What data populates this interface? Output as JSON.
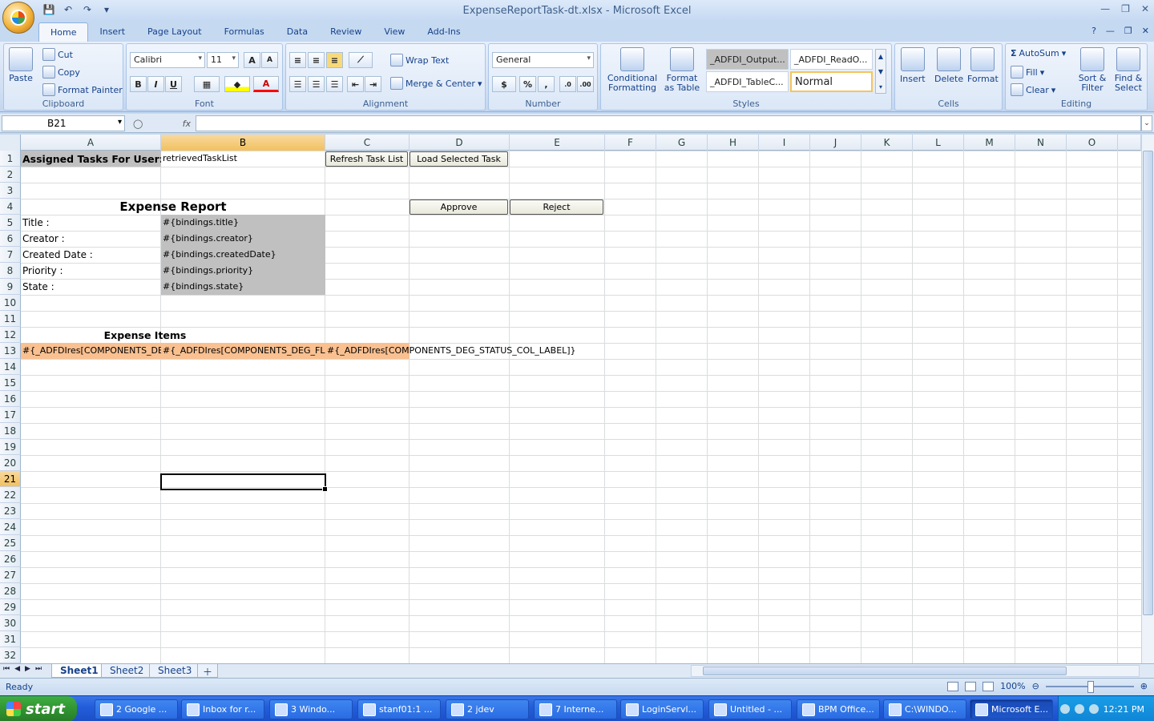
{
  "window": {
    "title": "ExpenseReportTask-dt.xlsx - Microsoft Excel"
  },
  "ribbon": {
    "tabs": [
      "Home",
      "Insert",
      "Page Layout",
      "Formulas",
      "Data",
      "Review",
      "View",
      "Add-Ins"
    ],
    "clipboard": {
      "paste": "Paste",
      "cut": "Cut",
      "copy": "Copy",
      "format_painter": "Format Painter",
      "label": "Clipboard"
    },
    "font": {
      "name": "Calibri",
      "size": "11",
      "bold": "B",
      "italic": "I",
      "underline": "U",
      "label": "Font"
    },
    "alignment": {
      "wrap_text": "Wrap Text",
      "merge_center": "Merge & Center",
      "label": "Alignment"
    },
    "number": {
      "format": "General",
      "currency": "$",
      "percent": "%",
      "comma": ",",
      "label": "Number"
    },
    "styles": {
      "conditional_formatting": "Conditional Formatting",
      "format_as_table": "Format as Table",
      "cells": [
        "_ADFDI_Output...",
        "_ADFDI_ReadO...",
        "_ADFDI_TableC...",
        "Normal"
      ],
      "label": "Styles"
    },
    "cells_group": {
      "insert": "Insert",
      "delete": "Delete",
      "format": "Format",
      "label": "Cells"
    },
    "editing": {
      "autosum": "AutoSum",
      "fill": "Fill",
      "clear": "Clear",
      "sort_filter": "Sort & Filter",
      "find_select": "Find & Select",
      "label": "Editing"
    }
  },
  "formula_bar": {
    "name_box": "B21",
    "fx": "fx",
    "value": ""
  },
  "columns": [
    "A",
    "B",
    "C",
    "D",
    "E",
    "F",
    "G",
    "H",
    "I",
    "J",
    "K",
    "L",
    "M",
    "N",
    "O"
  ],
  "rows": [
    "1",
    "2",
    "3",
    "4",
    "5",
    "6",
    "7",
    "8",
    "9",
    "10",
    "11",
    "12",
    "13",
    "14",
    "15",
    "16",
    "17",
    "18",
    "19",
    "20",
    "21",
    "22",
    "23",
    "24",
    "25",
    "26",
    "27",
    "28",
    "29",
    "30",
    "31",
    "32"
  ],
  "sheet": {
    "a1": "Assigned Tasks For User:",
    "b1": "retrievedTaskList",
    "refresh_btn": "Refresh Task List",
    "load_btn": "Load Selected Task",
    "heading": "Expense Report",
    "approve_btn": "Approve",
    "reject_btn": "Reject",
    "labels": [
      "Title :",
      "Creator :",
      "Created Date :",
      "Priority :",
      "State :"
    ],
    "bindings": [
      "#{bindings.title}",
      "#{bindings.creator}",
      "#{bindings.createdDate}",
      "#{bindings.priority}",
      "#{bindings.state}"
    ],
    "items_heading": "Expense Items",
    "a13": "#{_ADFDIres[COMPONENTS_DEG_",
    "b13": "#{_ADFDIres[COMPONENTS_DEG_FLAGG",
    "c13": "#{_ADFDIres[COMPONENTS_DEG_STATUS_COL_LABEL]}"
  },
  "sheet_tabs": [
    "Sheet1",
    "Sheet2",
    "Sheet3"
  ],
  "status": {
    "text": "Ready",
    "zoom": "100%"
  },
  "taskbar": {
    "start": "start",
    "items": [
      "2 Google ...",
      "Inbox for r...",
      "3 Windo...",
      "stanf01:1 ...",
      "2 jdev",
      "7 Interne...",
      "LoginServl...",
      "Untitled - ...",
      "BPM Office...",
      "C:\\WINDO...",
      "Microsoft E..."
    ],
    "clock": "12:21 PM"
  },
  "colors": {
    "grey_fill": "#c0c0c0",
    "orange_fill": "#fac090",
    "selected_header": "#f1c15f"
  }
}
